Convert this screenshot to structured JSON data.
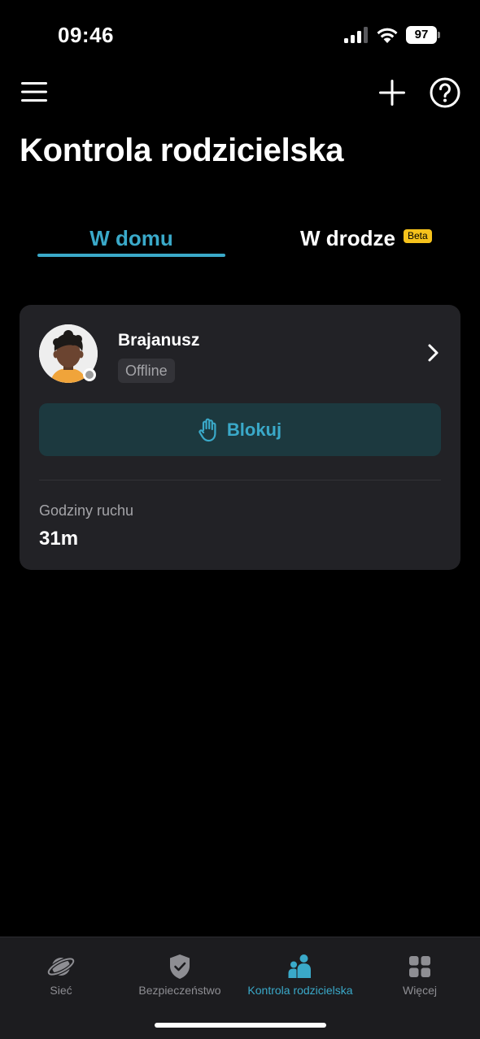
{
  "status_bar": {
    "time": "09:46",
    "battery": "97",
    "icons": [
      "signal-icon",
      "wifi-icon",
      "battery-icon"
    ]
  },
  "header": {
    "title": "Kontrola rodzicielska",
    "icons": [
      "menu-icon",
      "plus-icon",
      "help-icon"
    ]
  },
  "tabs": [
    {
      "label": "W domu",
      "active": true
    },
    {
      "label": "W drodze",
      "active": false,
      "badge": "Beta"
    }
  ],
  "profile_card": {
    "name": "Brajanusz",
    "status": "Offline",
    "block_label": "Blokuj",
    "traffic_label": "Godziny ruchu",
    "traffic_value": "31m"
  },
  "tabbar": {
    "items": [
      {
        "label": "Sieć",
        "icon": "planet-icon",
        "active": false
      },
      {
        "label": "Bezpieczeństwo",
        "icon": "shield-icon",
        "active": false
      },
      {
        "label": "Kontrola rodzicielska",
        "icon": "family-icon",
        "active": true
      },
      {
        "label": "Więcej",
        "icon": "grid-icon",
        "active": false
      }
    ]
  },
  "colors": {
    "accent": "#3aa9c9",
    "background": "#000000",
    "card": "#222226",
    "beta_badge": "#f6c21c",
    "block_button": "#1c393f"
  }
}
